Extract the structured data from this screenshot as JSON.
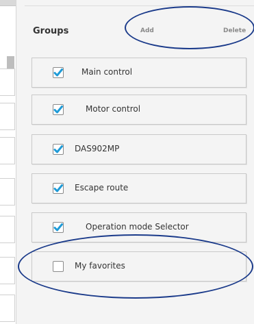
{
  "groups_panel": {
    "title": "Groups",
    "add_label": "Add",
    "delete_label": "Delete",
    "items": [
      {
        "label": "Main control",
        "checked": true
      },
      {
        "label": "Motor control",
        "checked": true
      },
      {
        "label": "DAS902MP",
        "checked": true
      },
      {
        "label": "Escape route",
        "checked": true
      },
      {
        "label": "Operation mode Selector",
        "checked": true
      },
      {
        "label": "My favorites",
        "checked": false
      }
    ]
  },
  "colors": {
    "checkmark": "#1f9bd7",
    "annotation": "#1a3a8a"
  }
}
